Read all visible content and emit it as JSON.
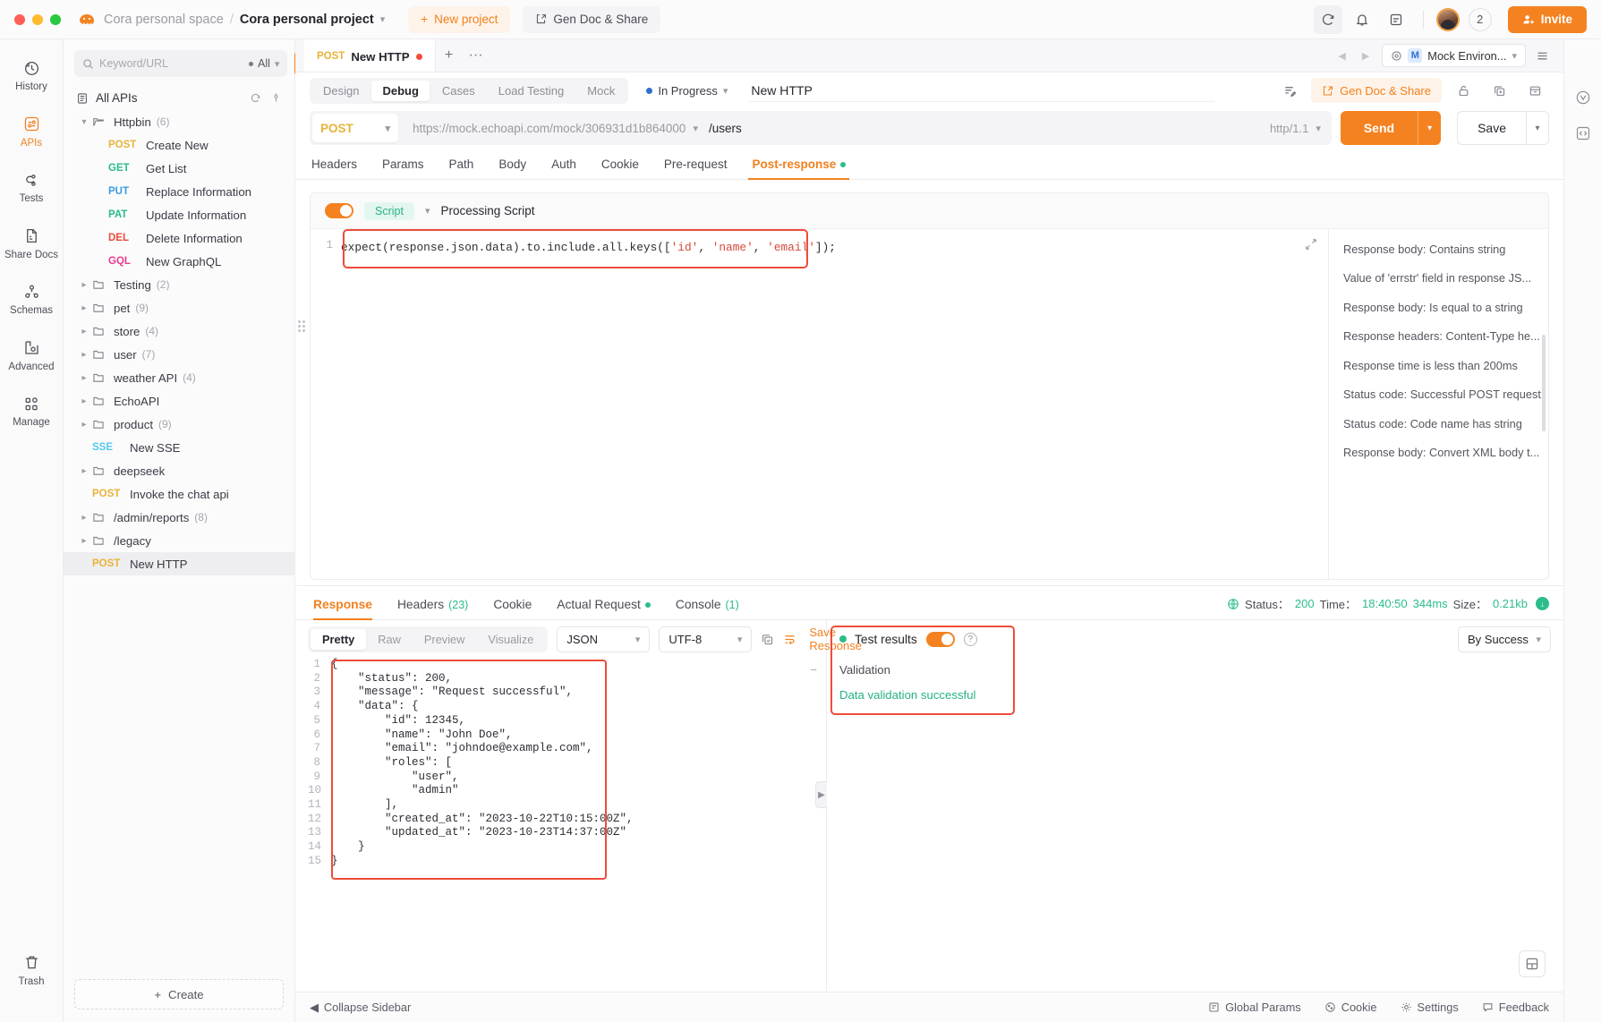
{
  "titlebar": {
    "space": "Cora personal space",
    "separator": "/",
    "project": "Cora personal project",
    "new_project": "New project",
    "gen_doc_share": "Gen Doc & Share",
    "member_count": "2",
    "invite": "Invite"
  },
  "rail": {
    "items": [
      {
        "label": "History",
        "icon": "history-icon"
      },
      {
        "label": "APIs",
        "icon": "apis-icon"
      },
      {
        "label": "Tests",
        "icon": "tests-icon"
      },
      {
        "label": "Share Docs",
        "icon": "share-docs-icon"
      },
      {
        "label": "Schemas",
        "icon": "schemas-icon"
      },
      {
        "label": "Advanced",
        "icon": "advanced-icon"
      },
      {
        "label": "Manage",
        "icon": "manage-icon"
      }
    ],
    "trash": "Trash"
  },
  "sidebar": {
    "search_placeholder": "Keyword/URL",
    "search_value": "",
    "scope": "All",
    "add_button": "+",
    "all_apis": "All APIs",
    "create": "Create",
    "tree": [
      {
        "type": "folder",
        "label": "Httpbin",
        "count": "(6)",
        "expanded": true
      },
      {
        "type": "api",
        "method": "POST",
        "method_class": "m-post",
        "label": "Create New"
      },
      {
        "type": "api",
        "method": "GET",
        "method_class": "m-get",
        "label": "Get List"
      },
      {
        "type": "api",
        "method": "PUT",
        "method_class": "m-put",
        "label": "Replace Information"
      },
      {
        "type": "api",
        "method": "PAT",
        "method_class": "m-pat",
        "label": "Update Information"
      },
      {
        "type": "api",
        "method": "DEL",
        "method_class": "m-del",
        "label": "Delete Information"
      },
      {
        "type": "api",
        "method": "GQL",
        "method_class": "m-gql",
        "label": "New GraphQL"
      },
      {
        "type": "folder",
        "label": "Testing",
        "count": "(2)",
        "expanded": false
      },
      {
        "type": "folder",
        "label": "pet",
        "count": "(9)",
        "expanded": false
      },
      {
        "type": "folder",
        "label": "store",
        "count": "(4)",
        "expanded": false
      },
      {
        "type": "folder",
        "label": "user",
        "count": "(7)",
        "expanded": false
      },
      {
        "type": "folder",
        "label": "weather API",
        "count": "(4)",
        "expanded": false
      },
      {
        "type": "folder",
        "label": "EchoAPI",
        "count": "",
        "expanded": false
      },
      {
        "type": "folder",
        "label": "product",
        "count": "(9)",
        "expanded": false
      },
      {
        "type": "api",
        "method": "SSE",
        "method_class": "m-sse",
        "label": "New SSE",
        "root": true
      },
      {
        "type": "folder",
        "label": "deepseek",
        "count": "",
        "expanded": false
      },
      {
        "type": "api",
        "method": "POST",
        "method_class": "m-post",
        "label": "Invoke the chat api",
        "root": true
      },
      {
        "type": "folder",
        "label": "/admin/reports",
        "count": "(8)",
        "expanded": false
      },
      {
        "type": "folder",
        "label": "/legacy",
        "count": "",
        "expanded": false
      },
      {
        "type": "api",
        "method": "POST",
        "method_class": "m-post",
        "label": "New HTTP",
        "root": true,
        "selected": true
      }
    ]
  },
  "tabstrip": {
    "doc_tab_method": "POST",
    "doc_tab_title": "New HTTP",
    "add": "+",
    "more": "···",
    "env_badge": "M",
    "env_name": "Mock Environ..."
  },
  "modes": {
    "items": [
      "Design",
      "Debug",
      "Cases",
      "Load Testing",
      "Mock"
    ],
    "active": "Debug",
    "status": "In Progress",
    "name_value": "New HTTP",
    "gen_doc_share": "Gen Doc & Share"
  },
  "request": {
    "method": "POST",
    "url_host": "https://mock.echoapi.com/mock/306931d1b864000",
    "url_path": "/users",
    "http_version": "http/1.1",
    "send": "Send",
    "save": "Save",
    "tabs": [
      "Headers",
      "Params",
      "Path",
      "Body",
      "Auth",
      "Cookie",
      "Pre-request",
      "Post-response"
    ],
    "active_tab": "Post-response"
  },
  "script": {
    "chip": "Script",
    "title": "Processing Script",
    "enabled": true,
    "line_number": "1",
    "code_prefix": "expect(response.json.data).to.include.all.keys([",
    "code_str1": "'id'",
    "code_sep1": ", ",
    "code_str2": "'name'",
    "code_sep2": ", ",
    "code_str3": "'email'",
    "code_suffix": "]);",
    "snippets": [
      "Response body: Contains string",
      "Value of 'errstr' field in response JS...",
      "Response body: Is equal to a string",
      "Response headers: Content-Type he...",
      "Response time is less than 200ms",
      "Status code: Successful POST request",
      "Status code: Code name has string",
      "Response body: Convert XML body t..."
    ]
  },
  "response": {
    "tabs": [
      {
        "label": "Response",
        "count": ""
      },
      {
        "label": "Headers",
        "count": "(23)"
      },
      {
        "label": "Cookie",
        "count": ""
      },
      {
        "label": "Actual Request",
        "count": ""
      },
      {
        "label": "Console",
        "count": "(1)"
      }
    ],
    "active_tab": "Response",
    "meta": {
      "status_label": "Status：",
      "status_value": "200",
      "time_label": "Time：",
      "time_value": "18:40:50",
      "duration": "344ms",
      "size_label": "Size：",
      "size_value": "0.21kb"
    },
    "format_modes": [
      "Pretty",
      "Raw",
      "Preview",
      "Visualize"
    ],
    "format_active": "Pretty",
    "content_type": "JSON",
    "charset": "UTF-8",
    "save_response": "Save Response",
    "json_lines": [
      {
        "n": "1",
        "code": "{"
      },
      {
        "n": "2",
        "code": "    \"status\": 200,"
      },
      {
        "n": "3",
        "code": "    \"message\": \"Request successful\","
      },
      {
        "n": "4",
        "code": "    \"data\": {"
      },
      {
        "n": "5",
        "code": "        \"id\": 12345,"
      },
      {
        "n": "6",
        "code": "        \"name\": \"John Doe\","
      },
      {
        "n": "7",
        "code": "        \"email\": \"johndoe@example.com\","
      },
      {
        "n": "8",
        "code": "        \"roles\": ["
      },
      {
        "n": "9",
        "code": "            \"user\","
      },
      {
        "n": "10",
        "code": "            \"admin\""
      },
      {
        "n": "11",
        "code": "        ],"
      },
      {
        "n": "12",
        "code": "        \"created_at\": \"2023-10-22T10:15:00Z\","
      },
      {
        "n": "13",
        "code": "        \"updated_at\": \"2023-10-23T14:37:00Z\""
      },
      {
        "n": "14",
        "code": "    }"
      },
      {
        "n": "15",
        "code": "}"
      }
    ]
  },
  "test_results": {
    "title": "Test results",
    "enabled": true,
    "filter": "By Success",
    "group": "Validation",
    "passed": "Data validation successful"
  },
  "footer": {
    "collapse_sidebar": "Collapse Sidebar",
    "global_params": "Global Params",
    "cookie": "Cookie",
    "settings": "Settings",
    "feedback": "Feedback"
  },
  "colors": {
    "accent": "#f58220",
    "success": "#2bbd8c",
    "danger": "#ef4b3a",
    "info": "#2f6fd0"
  }
}
